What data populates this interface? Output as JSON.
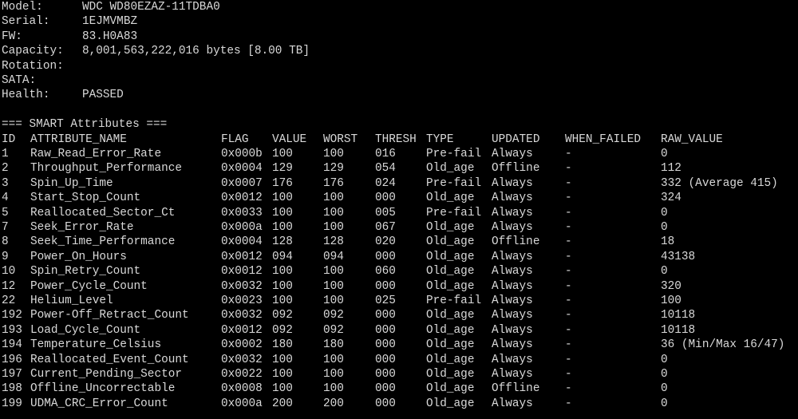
{
  "device_info": [
    {
      "key": "Model:",
      "value": "WDC WD80EZAZ-11TDBA0"
    },
    {
      "key": "Serial:",
      "value": "1EJMVMBZ"
    },
    {
      "key": "FW:",
      "value": "83.H0A83"
    },
    {
      "key": "Capacity:",
      "value": "8,001,563,222,016 bytes [8.00 TB]"
    },
    {
      "key": "Rotation:",
      "value": ""
    },
    {
      "key": "SATA:",
      "value": ""
    },
    {
      "key": "Health:",
      "value": "PASSED"
    }
  ],
  "smart_title": "=== SMART Attributes ===",
  "columns": {
    "id": "ID",
    "name": "ATTRIBUTE_NAME",
    "flag": "FLAG",
    "value": "VALUE",
    "worst": "WORST",
    "thresh": "THRESH",
    "type": "TYPE",
    "updated": "UPDATED",
    "when_failed": "WHEN_FAILED",
    "raw": "RAW_VALUE"
  },
  "attributes": [
    {
      "id": "1",
      "name": "Raw_Read_Error_Rate",
      "flag": "0x000b",
      "value": "100",
      "worst": "100",
      "thresh": "016",
      "type": "Pre-fail",
      "updated": "Always",
      "when_failed": "-",
      "raw": "0"
    },
    {
      "id": "2",
      "name": "Throughput_Performance",
      "flag": "0x0004",
      "value": "129",
      "worst": "129",
      "thresh": "054",
      "type": "Old_age",
      "updated": "Offline",
      "when_failed": "-",
      "raw": "112"
    },
    {
      "id": "3",
      "name": "Spin_Up_Time",
      "flag": "0x0007",
      "value": "176",
      "worst": "176",
      "thresh": "024",
      "type": "Pre-fail",
      "updated": "Always",
      "when_failed": "-",
      "raw": "332 (Average 415)"
    },
    {
      "id": "4",
      "name": "Start_Stop_Count",
      "flag": "0x0012",
      "value": "100",
      "worst": "100",
      "thresh": "000",
      "type": "Old_age",
      "updated": "Always",
      "when_failed": "-",
      "raw": "324"
    },
    {
      "id": "5",
      "name": "Reallocated_Sector_Ct",
      "flag": "0x0033",
      "value": "100",
      "worst": "100",
      "thresh": "005",
      "type": "Pre-fail",
      "updated": "Always",
      "when_failed": "-",
      "raw": "0"
    },
    {
      "id": "7",
      "name": "Seek_Error_Rate",
      "flag": "0x000a",
      "value": "100",
      "worst": "100",
      "thresh": "067",
      "type": "Old_age",
      "updated": "Always",
      "when_failed": "-",
      "raw": "0"
    },
    {
      "id": "8",
      "name": "Seek_Time_Performance",
      "flag": "0x0004",
      "value": "128",
      "worst": "128",
      "thresh": "020",
      "type": "Old_age",
      "updated": "Offline",
      "when_failed": "-",
      "raw": "18"
    },
    {
      "id": "9",
      "name": "Power_On_Hours",
      "flag": "0x0012",
      "value": "094",
      "worst": "094",
      "thresh": "000",
      "type": "Old_age",
      "updated": "Always",
      "when_failed": "-",
      "raw": "43138"
    },
    {
      "id": "10",
      "name": "Spin_Retry_Count",
      "flag": "0x0012",
      "value": "100",
      "worst": "100",
      "thresh": "060",
      "type": "Old_age",
      "updated": "Always",
      "when_failed": "-",
      "raw": "0"
    },
    {
      "id": "12",
      "name": "Power_Cycle_Count",
      "flag": "0x0032",
      "value": "100",
      "worst": "100",
      "thresh": "000",
      "type": "Old_age",
      "updated": "Always",
      "when_failed": "-",
      "raw": "320"
    },
    {
      "id": "22",
      "name": "Helium_Level",
      "flag": "0x0023",
      "value": "100",
      "worst": "100",
      "thresh": "025",
      "type": "Pre-fail",
      "updated": "Always",
      "when_failed": "-",
      "raw": "100"
    },
    {
      "id": "192",
      "name": "Power-Off_Retract_Count",
      "flag": "0x0032",
      "value": "092",
      "worst": "092",
      "thresh": "000",
      "type": "Old_age",
      "updated": "Always",
      "when_failed": "-",
      "raw": "10118"
    },
    {
      "id": "193",
      "name": "Load_Cycle_Count",
      "flag": "0x0012",
      "value": "092",
      "worst": "092",
      "thresh": "000",
      "type": "Old_age",
      "updated": "Always",
      "when_failed": "-",
      "raw": "10118"
    },
    {
      "id": "194",
      "name": "Temperature_Celsius",
      "flag": "0x0002",
      "value": "180",
      "worst": "180",
      "thresh": "000",
      "type": "Old_age",
      "updated": "Always",
      "when_failed": "-",
      "raw": "36 (Min/Max 16/47)"
    },
    {
      "id": "196",
      "name": "Reallocated_Event_Count",
      "flag": "0x0032",
      "value": "100",
      "worst": "100",
      "thresh": "000",
      "type": "Old_age",
      "updated": "Always",
      "when_failed": "-",
      "raw": "0"
    },
    {
      "id": "197",
      "name": "Current_Pending_Sector",
      "flag": "0x0022",
      "value": "100",
      "worst": "100",
      "thresh": "000",
      "type": "Old_age",
      "updated": "Always",
      "when_failed": "-",
      "raw": "0"
    },
    {
      "id": "198",
      "name": "Offline_Uncorrectable",
      "flag": "0x0008",
      "value": "100",
      "worst": "100",
      "thresh": "000",
      "type": "Old_age",
      "updated": "Offline",
      "when_failed": "-",
      "raw": "0"
    },
    {
      "id": "199",
      "name": "UDMA_CRC_Error_Count",
      "flag": "0x000a",
      "value": "200",
      "worst": "200",
      "thresh": "000",
      "type": "Old_age",
      "updated": "Always",
      "when_failed": "-",
      "raw": "0"
    }
  ]
}
